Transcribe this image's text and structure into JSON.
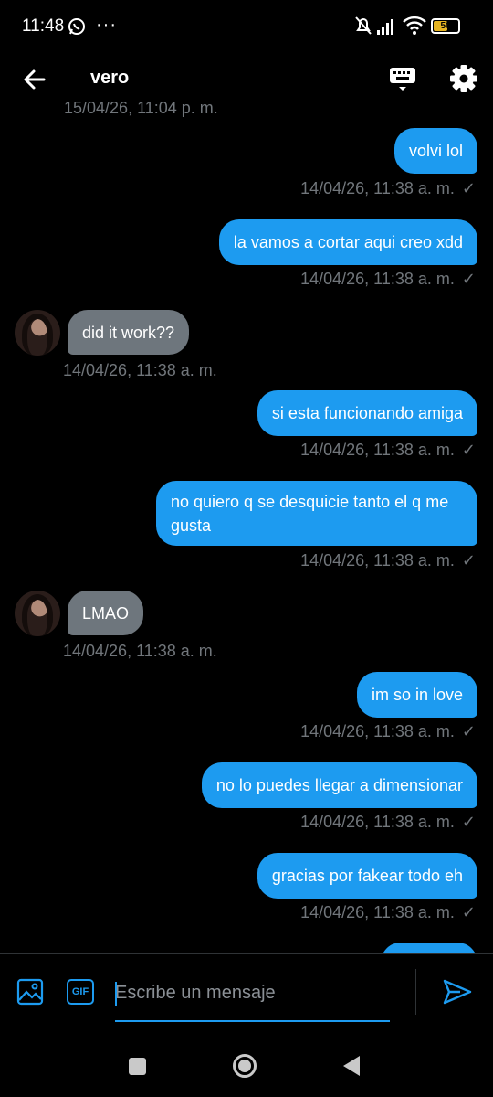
{
  "status": {
    "time": "11:48",
    "more": "···",
    "battery": "50"
  },
  "header": {
    "title": "vero"
  },
  "cutoff_timestamp": "15/04/26, 11:04 p. m.",
  "messages": [
    {
      "dir": "out",
      "text": "volvi lol",
      "time": "14/04/26, 11:38 a. m."
    },
    {
      "dir": "out",
      "text": "la vamos a cortar aqui creo xdd",
      "time": "14/04/26, 11:38 a. m."
    },
    {
      "dir": "in",
      "text": "did it work??",
      "time": "14/04/26, 11:38 a. m."
    },
    {
      "dir": "out",
      "text": "si esta funcionando amiga",
      "time": "14/04/26, 11:38 a. m."
    },
    {
      "dir": "out",
      "text": "no quiero q se desquicie tanto el q me gusta",
      "time": "14/04/26, 11:38 a. m."
    },
    {
      "dir": "in",
      "text": "LMAO",
      "time": "14/04/26, 11:38 a. m."
    },
    {
      "dir": "out",
      "text": "im so in love",
      "time": "14/04/26, 11:38 a. m."
    },
    {
      "dir": "out",
      "text": "no lo puedes llegar a dimensionar",
      "time": "14/04/26, 11:38 a. m."
    },
    {
      "dir": "out",
      "text": "gracias por fakear todo eh",
      "time": "14/04/26, 11:38 a. m."
    }
  ],
  "sent_mark": "✓",
  "composer": {
    "placeholder": "Escribe un mensaje",
    "gif_label": "GIF"
  },
  "colors": {
    "accent": "#1d9bf0",
    "incoming": "#6e767d",
    "meta": "#71767b",
    "background": "#000000"
  }
}
